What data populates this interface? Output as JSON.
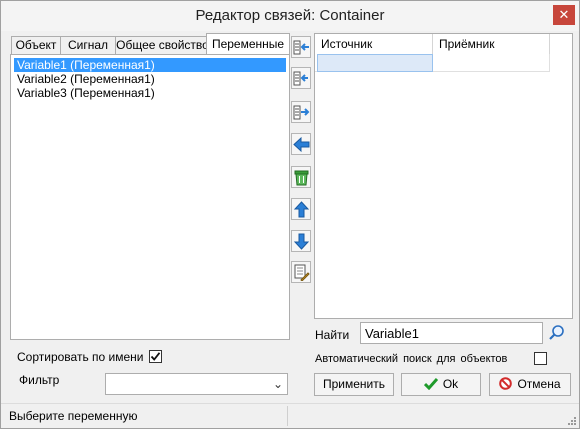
{
  "window": {
    "title": "Редактор связей: Container",
    "close_glyph": "✕"
  },
  "tabs": [
    {
      "label": "Объект"
    },
    {
      "label": "Сигнал"
    },
    {
      "label": "Общее свойство"
    },
    {
      "label": "Переменные",
      "active": true
    }
  ],
  "variables": [
    {
      "label": "Variable1  (Переменная1)",
      "selected": true
    },
    {
      "label": "Variable2  (Переменная1)"
    },
    {
      "label": "Variable3  (Переменная1)"
    }
  ],
  "toolbar": [
    {
      "icon": "link-source-icon"
    },
    {
      "icon": "link-target-icon"
    },
    {
      "icon": "link-both-icon"
    },
    {
      "icon": "arrow-left-icon"
    },
    {
      "icon": "trash-icon"
    },
    {
      "icon": "arrow-up-icon"
    },
    {
      "icon": "arrow-down-icon"
    },
    {
      "icon": "document-edit-icon"
    }
  ],
  "grid": {
    "columns": [
      "Источник",
      "Приёмник"
    ],
    "rows": [
      [
        "",
        ""
      ]
    ]
  },
  "options": {
    "sort_label": "Сортировать по имени",
    "sort_checked": true,
    "filter_label": "Фильтр",
    "filter_value": "",
    "find_label": "Найти",
    "find_value": "Variable1",
    "auto_search_label": "Автоматический поиск для объектов",
    "auto_search_checked": false
  },
  "buttons": {
    "apply": "Применить",
    "ok": "Ok",
    "cancel": "Отмена"
  },
  "status": {
    "text": "Выберите переменную"
  },
  "colors": {
    "selection": "#3399ff",
    "close": "#c7463b",
    "ok_green": "#1e9a2a",
    "cancel_red": "#d22b2b",
    "arrow_blue": "#2b7fd6"
  }
}
